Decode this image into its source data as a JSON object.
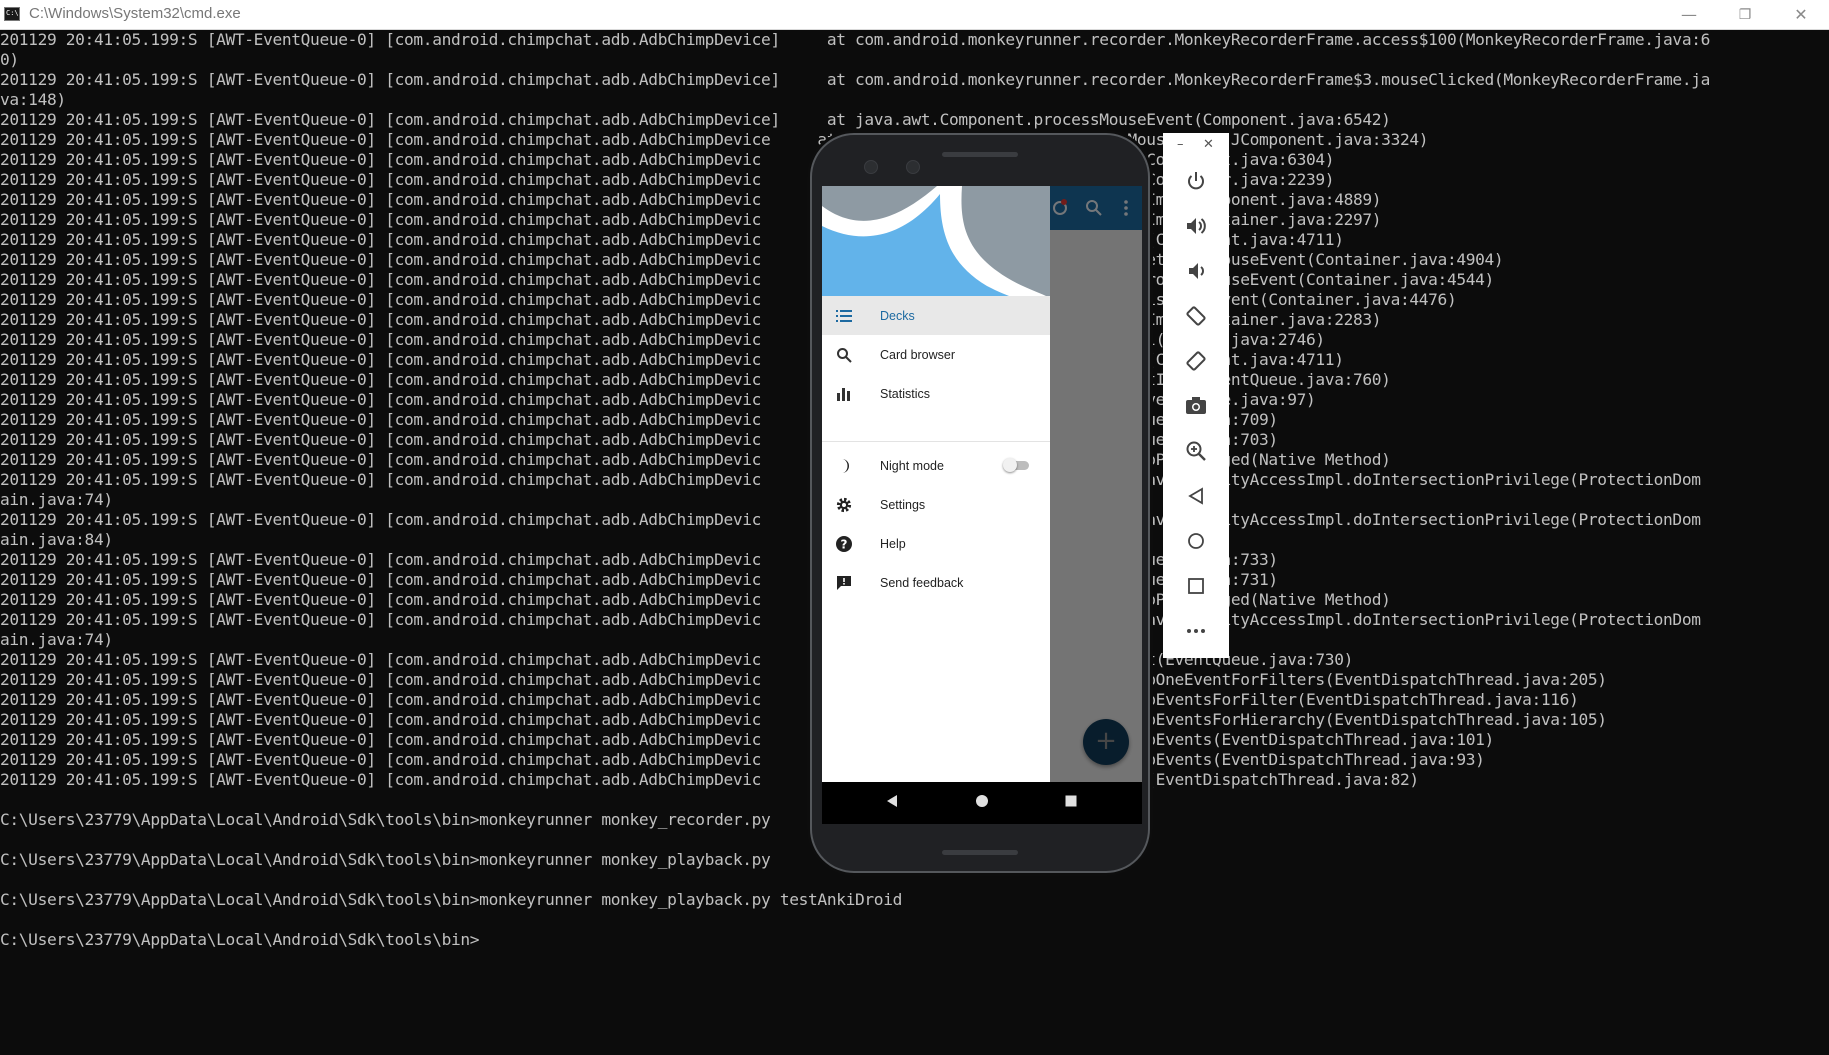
{
  "window": {
    "title": "C:\\Windows\\System32\\cmd.exe",
    "minimize_symbol": "—",
    "restore_symbol": "❐",
    "close_symbol": "✕"
  },
  "terminal": {
    "lines": [
      "201129 20:41:05.199:S [AWT-EventQueue-0] [com.android.chimpchat.adb.AdbChimpDevice]     at com.android.monkeyrunner.recorder.MonkeyRecorderFrame.access$100(MonkeyRecorderFrame.java:6",
      "0)",
      "201129 20:41:05.199:S [AWT-EventQueue-0] [com.android.chimpchat.adb.AdbChimpDevice]     at com.android.monkeyrunner.recorder.MonkeyRecorderFrame$3.mouseClicked(MonkeyRecorderFrame.ja",
      "va:148)",
      "201129 20:41:05.199:S [AWT-EventQueue-0] [com.android.chimpchat.adb.AdbChimpDevice]     at java.awt.Component.processMouseEvent(Component.java:6542)",
      "201129 20:41:05.199:S [AWT-EventQueue-0] [com.android.chimpchat.adb.AdbChimpDevice     at javax.swing.JComponent.processMouseEvent(JComponent.java:3324)",
      "201129 20:41:05.199:S [AWT-EventQueue-0] [com.android.chimpchat.adb.AdbChimpDevic      at java.awt.Component.processEvent(Component.java:6304)",
      "201129 20:41:05.199:S [AWT-EventQueue-0] [com.android.chimpchat.adb.AdbChimpDevic      at java.awt.Container.processEvent(Container.java:2239)",
      "201129 20:41:05.199:S [AWT-EventQueue-0] [com.android.chimpchat.adb.AdbChimpDevic      at java.awt.Component.dispatchEventImpl(Component.java:4889)",
      "201129 20:41:05.199:S [AWT-EventQueue-0] [com.android.chimpchat.adb.AdbChimpDevic      at java.awt.Container.dispatchEventImpl(Container.java:2297)",
      "201129 20:41:05.199:S [AWT-EventQueue-0] [com.android.chimpchat.adb.AdbChimpDevic      at java.awt.Component.dispatchEvent(Component.java:4711)",
      "201129 20:41:05.199:S [AWT-EventQueue-0] [com.android.chimpchat.adb.AdbChimpDevic      at java.awt.LightweightDispatcher.retargetMouseEvent(Container.java:4904)",
      "201129 20:41:05.199:S [AWT-EventQueue-0] [com.android.chimpchat.adb.AdbChimpDevic      at java.awt.LightweightDispatcher.processMouseEvent(Container.java:4544)",
      "201129 20:41:05.199:S [AWT-EventQueue-0] [com.android.chimpchat.adb.AdbChimpDevic      at java.awt.LightweightDispatcher.dispatchEvent(Container.java:4476)",
      "201129 20:41:05.199:S [AWT-EventQueue-0] [com.android.chimpchat.adb.AdbChimpDevic      at java.awt.Container.dispatchEventImpl(Container.java:2283)",
      "201129 20:41:05.199:S [AWT-EventQueue-0] [com.android.chimpchat.adb.AdbChimpDevic      at java.awt.Window.dispatchEventImpl(Window.java:2746)",
      "201129 20:41:05.199:S [AWT-EventQueue-0] [com.android.chimpchat.adb.AdbChimpDevic      at java.awt.Component.dispatchEvent(Component.java:4711)",
      "201129 20:41:05.199:S [AWT-EventQueue-0] [com.android.chimpchat.adb.AdbChimpDevic      at java.awt.EventQueue.dispatchEventImpl(EventQueue.java:760)",
      "201129 20:41:05.199:S [AWT-EventQueue-0] [com.android.chimpchat.adb.AdbChimpDevic      at java.awt.EventQueue.access$500(EventQueue.java:97)",
      "201129 20:41:05.199:S [AWT-EventQueue-0] [com.android.chimpchat.adb.AdbChimpDevic      at java.awt.EventQueue$3.run(EventQueue.java:709)",
      "201129 20:41:05.199:S [AWT-EventQueue-0] [com.android.chimpchat.adb.AdbChimpDevic      at java.awt.EventQueue$3.run(EventQueue.java:703)",
      "201129 20:41:05.199:S [AWT-EventQueue-0] [com.android.chimpchat.adb.AdbChimpDevic      at java.security.AccessController.doPrivileged(Native Method)",
      "201129 20:41:05.199:S [AWT-EventQueue-0] [com.android.chimpchat.adb.AdbChimpDevic      at java.security.ProtectionDomain$JavaSecurityAccessImpl.doIntersectionPrivilege(ProtectionDom",
      "ain.java:74)",
      "201129 20:41:05.199:S [AWT-EventQueue-0] [com.android.chimpchat.adb.AdbChimpDevic      at java.security.ProtectionDomain$JavaSecurityAccessImpl.doIntersectionPrivilege(ProtectionDom",
      "ain.java:84)",
      "201129 20:41:05.199:S [AWT-EventQueue-0] [com.android.chimpchat.adb.AdbChimpDevic      at java.awt.EventQueue$4.run(EventQueue.java:733)",
      "201129 20:41:05.199:S [AWT-EventQueue-0] [com.android.chimpchat.adb.AdbChimpDevic      at java.awt.EventQueue$4.run(EventQueue.java:731)",
      "201129 20:41:05.199:S [AWT-EventQueue-0] [com.android.chimpchat.adb.AdbChimpDevic      at java.security.AccessController.doPrivileged(Native Method)",
      "201129 20:41:05.199:S [AWT-EventQueue-0] [com.android.chimpchat.adb.AdbChimpDevic      at java.security.ProtectionDomain$JavaSecurityAccessImpl.doIntersectionPrivilege(ProtectionDom",
      "ain.java:74)",
      "201129 20:41:05.199:S [AWT-EventQueue-0] [com.android.chimpchat.adb.AdbChimpDevic      at java.awt.EventQueue.dispatchEvent(EventQueue.java:730)",
      "201129 20:41:05.199:S [AWT-EventQueue-0] [com.android.chimpchat.adb.AdbChimpDevic      at java.awt.EventDispatchThread.pumpOneEventForFilters(EventDispatchThread.java:205)",
      "201129 20:41:05.199:S [AWT-EventQueue-0] [com.android.chimpchat.adb.AdbChimpDevic      at java.awt.EventDispatchThread.pumpEventsForFilter(EventDispatchThread.java:116)",
      "201129 20:41:05.199:S [AWT-EventQueue-0] [com.android.chimpchat.adb.AdbChimpDevic      at java.awt.EventDispatchThread.pumpEventsForHierarchy(EventDispatchThread.java:105)",
      "201129 20:41:05.199:S [AWT-EventQueue-0] [com.android.chimpchat.adb.AdbChimpDevic      at java.awt.EventDispatchThread.pumpEvents(EventDispatchThread.java:101)",
      "201129 20:41:05.199:S [AWT-EventQueue-0] [com.android.chimpchat.adb.AdbChimpDevic      at java.awt.EventDispatchThread.pumpEvents(EventDispatchThread.java:93)",
      "201129 20:41:05.199:S [AWT-EventQueue-0] [com.android.chimpchat.adb.AdbChimpDevic      at java.awt.EventDispatchThread.run(EventDispatchThread.java:82)",
      "",
      "C:\\Users\\23779\\AppData\\Local\\Android\\Sdk\\tools\\bin>monkeyrunner monkey_recorder.py",
      "",
      "C:\\Users\\23779\\AppData\\Local\\Android\\Sdk\\tools\\bin>monkeyrunner monkey_playback.py",
      "",
      "C:\\Users\\23779\\AppData\\Local\\Android\\Sdk\\tools\\bin>monkeyrunner monkey_playback.py testAnkiDroid",
      "",
      "C:\\Users\\23779\\AppData\\Local\\Android\\Sdk\\tools\\bin>"
    ]
  },
  "emulator": {
    "appbar_icons": [
      "sync-icon",
      "search-icon",
      "more-vert-icon"
    ],
    "fab_label": "+",
    "drawer": {
      "items": [
        {
          "label": "Decks",
          "icon": "list-icon",
          "selected": true
        },
        {
          "label": "Card browser",
          "icon": "search-icon",
          "selected": false
        },
        {
          "label": "Statistics",
          "icon": "bar-chart-icon",
          "selected": false
        },
        {
          "label": "Night mode",
          "icon": "moon-icon",
          "selected": false,
          "toggle": false
        },
        {
          "label": "Settings",
          "icon": "gear-icon",
          "selected": false
        },
        {
          "label": "Help",
          "icon": "help-icon",
          "selected": false
        },
        {
          "label": "Send feedback",
          "icon": "feedback-icon",
          "selected": false
        }
      ]
    },
    "nav": [
      "back-icon",
      "home-icon",
      "recents-icon"
    ],
    "toolbar": {
      "minimize_symbol": "–",
      "close_symbol": "✕",
      "buttons": [
        "power-icon",
        "volume-up-icon",
        "volume-down-icon",
        "rotate-left-icon",
        "rotate-right-icon",
        "camera-icon",
        "zoom-icon",
        "back-icon",
        "home-icon",
        "overview-icon",
        "more-icon"
      ]
    }
  },
  "colors": {
    "terminal_bg": "#0c0c0c",
    "terminal_text": "#c0c0c0",
    "accent": "#1d6aa1",
    "drawer_header_blue": "#62b3ea"
  }
}
